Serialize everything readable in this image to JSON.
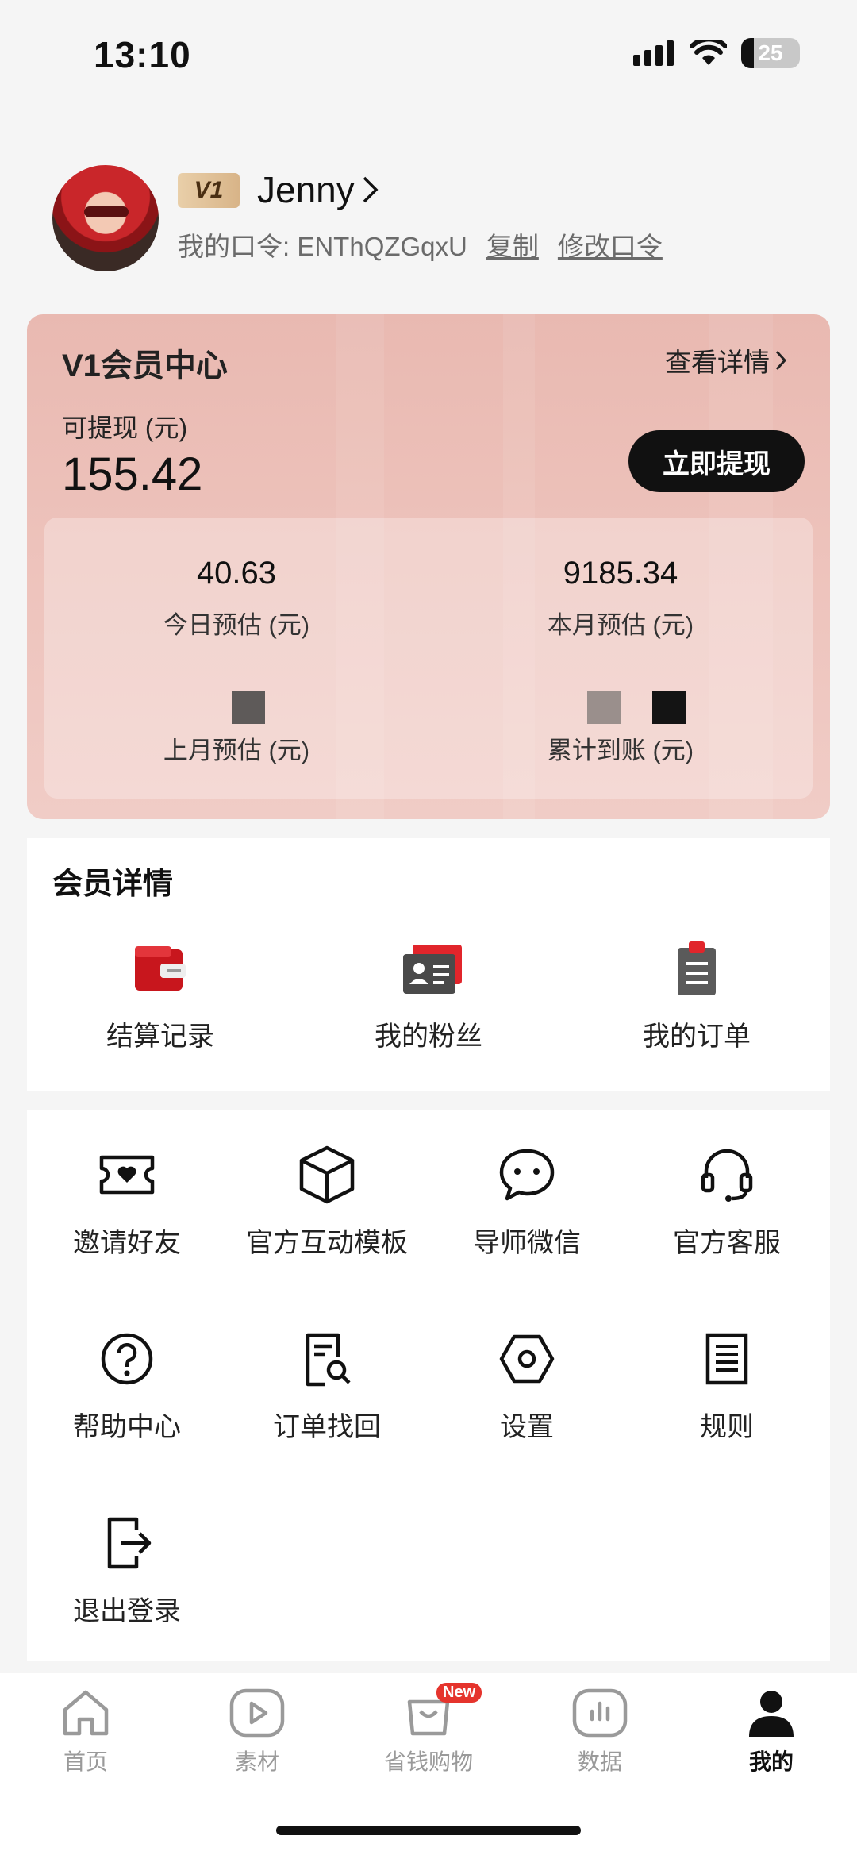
{
  "status_bar": {
    "time": "13:10",
    "battery": "25"
  },
  "profile": {
    "level": "V1",
    "name": "Jenny",
    "code_label": "我的口令: ENThQZGqxU",
    "copy": "复制",
    "edit_code": "修改口令"
  },
  "member_card": {
    "title": "V1会员中心",
    "detail_link": "查看详情",
    "withdraw_label": "可提现 (元)",
    "withdraw_value": "155.42",
    "withdraw_button": "立即提现",
    "stats": [
      {
        "value": "40.63",
        "label": "今日预估 (元)"
      },
      {
        "value": "9185.34",
        "label": "本月预估 (元)"
      },
      {
        "value": "",
        "label": "上月预估 (元)"
      },
      {
        "value": "",
        "label": "累计到账 (元)"
      }
    ],
    "colors": {
      "card_top": "#e9b9b1",
      "card_bottom": "#f0ccc6",
      "button": "#111111"
    }
  },
  "member_details": {
    "title": "会员详情",
    "items": [
      {
        "label": "结算记录",
        "icon": "wallet-icon"
      },
      {
        "label": "我的粉丝",
        "icon": "fans-card-icon"
      },
      {
        "label": "我的订单",
        "icon": "order-clipboard-icon"
      }
    ]
  },
  "tools": {
    "items": [
      {
        "label": "邀请好友",
        "icon": "ticket-heart-icon"
      },
      {
        "label": "官方互动模板",
        "icon": "cube-icon"
      },
      {
        "label": "导师微信",
        "icon": "chat-bubble-icon"
      },
      {
        "label": "官方客服",
        "icon": "headset-icon"
      },
      {
        "label": "帮助中心",
        "icon": "question-icon"
      },
      {
        "label": "订单找回",
        "icon": "document-search-icon"
      },
      {
        "label": "设置",
        "icon": "settings-hex-icon"
      },
      {
        "label": "规则",
        "icon": "rules-list-icon"
      },
      {
        "label": "退出登录",
        "icon": "logout-icon"
      }
    ]
  },
  "tabbar": {
    "items": [
      {
        "label": "首页",
        "icon": "home-icon"
      },
      {
        "label": "素材",
        "icon": "play-icon"
      },
      {
        "label": "省钱购物",
        "icon": "shopping-bag-icon",
        "badge": "New"
      },
      {
        "label": "数据",
        "icon": "chart-icon"
      },
      {
        "label": "我的",
        "icon": "person-icon",
        "active": true
      }
    ]
  }
}
